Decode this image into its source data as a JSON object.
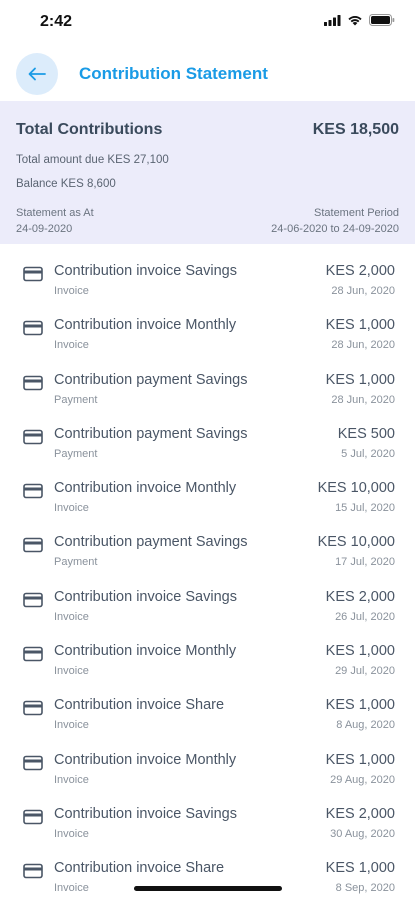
{
  "status": {
    "time": "2:42"
  },
  "header": {
    "title": "Contribution Statement"
  },
  "summary": {
    "title": "Total Contributions",
    "amount": "KES 18,500",
    "due": "Total amount due KES 27,100",
    "balance": "Balance KES 8,600",
    "as_at_label": "Statement as At",
    "as_at_value": "24-09-2020",
    "period_label": "Statement Period",
    "period_value": "24-06-2020 to 24-09-2020"
  },
  "transactions": [
    {
      "title": "Contribution invoice Savings",
      "type": "Invoice",
      "amount": "KES 2,000",
      "date": "28 Jun, 2020"
    },
    {
      "title": "Contribution invoice Monthly",
      "type": "Invoice",
      "amount": "KES 1,000",
      "date": "28 Jun, 2020"
    },
    {
      "title": "Contribution payment Savings",
      "type": "Payment",
      "amount": "KES 1,000",
      "date": "28 Jun, 2020"
    },
    {
      "title": "Contribution payment Savings",
      "type": "Payment",
      "amount": "KES 500",
      "date": "5 Jul, 2020"
    },
    {
      "title": "Contribution invoice Monthly",
      "type": "Invoice",
      "amount": "KES 10,000",
      "date": "15 Jul, 2020"
    },
    {
      "title": "Contribution payment Savings",
      "type": "Payment",
      "amount": "KES 10,000",
      "date": "17 Jul, 2020"
    },
    {
      "title": "Contribution invoice Savings",
      "type": "Invoice",
      "amount": "KES 2,000",
      "date": "26 Jul, 2020"
    },
    {
      "title": "Contribution invoice Monthly",
      "type": "Invoice",
      "amount": "KES 1,000",
      "date": "29 Jul, 2020"
    },
    {
      "title": "Contribution invoice Share",
      "type": "Invoice",
      "amount": "KES 1,000",
      "date": "8 Aug, 2020"
    },
    {
      "title": "Contribution invoice Monthly",
      "type": "Invoice",
      "amount": "KES 1,000",
      "date": "29 Aug, 2020"
    },
    {
      "title": "Contribution invoice Savings",
      "type": "Invoice",
      "amount": "KES 2,000",
      "date": "30 Aug, 2020"
    },
    {
      "title": "Contribution invoice Share",
      "type": "Invoice",
      "amount": "KES 1,000",
      "date": "8 Sep, 2020"
    }
  ],
  "icons": {
    "back": "arrow-left-icon",
    "row": "credit-card-icon",
    "signal": "signal-icon",
    "wifi": "wifi-icon",
    "battery": "battery-icon"
  },
  "colors": {
    "accent": "#1a9be6",
    "summary_bg": "#ececfa",
    "back_bg": "#dcecfb"
  }
}
